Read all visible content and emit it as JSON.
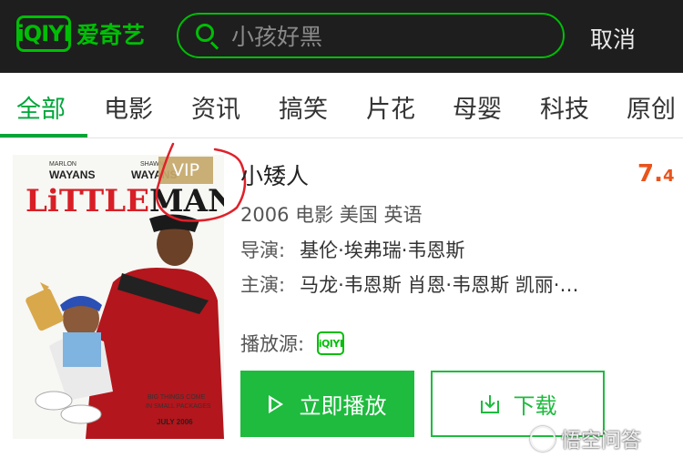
{
  "header": {
    "logo_mark": "iQIYI",
    "logo_text": "爱奇艺",
    "search_value": "小孩好黑",
    "cancel_label": "取消"
  },
  "tabs": [
    {
      "label": "全部",
      "active": true
    },
    {
      "label": "电影"
    },
    {
      "label": "资讯"
    },
    {
      "label": "搞笑"
    },
    {
      "label": "片花"
    },
    {
      "label": "母婴"
    },
    {
      "label": "科技"
    },
    {
      "label": "原创"
    }
  ],
  "result": {
    "poster": {
      "top_left_name": "MARLON\nWAYANS",
      "top_right_name": "SHAWN\nWAYANS",
      "title_art": "LiTTLEMAN",
      "tagline": "BIG THINGS COME\nIN SMALL PACKAGES",
      "date": "JULY 2006"
    },
    "vip_badge": "VIP",
    "title": "小矮人",
    "score_int": "7.",
    "score_dec": "4",
    "meta": "2006 电影 美国 英语",
    "director_label": "导演:",
    "director": "基伦·埃弗瑞·韦恩斯",
    "cast_label": "主演:",
    "cast": "马龙·韦恩斯 肖恩·韦恩斯 凯丽·…",
    "source_label": "播放源:",
    "source_logo": "iQIYI",
    "play_label": "立即播放",
    "download_label": "下载"
  },
  "watermark": "悟空问答",
  "colors": {
    "brand_green": "#00be06",
    "score_orange": "#e9541c",
    "vip_gold": "#c6a96c",
    "annotation_red": "#e0202a"
  }
}
